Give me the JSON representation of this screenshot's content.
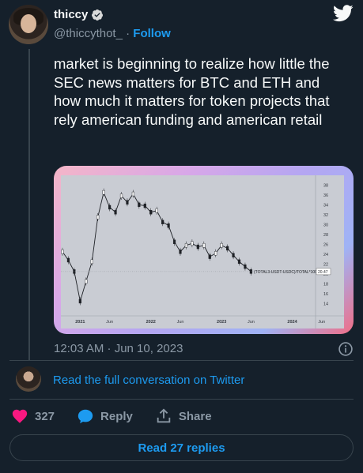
{
  "user": {
    "display_name": "thiccy",
    "handle": "@thiccythot_",
    "separator": "·",
    "follow_label": "Follow"
  },
  "tweet": {
    "text": "market is beginning to realize how little the SEC news matters for BTC and ETH and how much it matters for token projects that rely american funding and american retail",
    "timestamp": "12:03 AM · Jun 10, 2023"
  },
  "chart_data": {
    "type": "line",
    "title": "",
    "series_label": "(TOTAL3-USDT-USDC)/TOTAL*100",
    "last_value": "20.47",
    "x_ticks": [
      "2021",
      "Jun",
      "2022",
      "Jun",
      "2023",
      "Jun",
      "2024",
      "Jun"
    ],
    "y_ticks": [
      38,
      36,
      34,
      32,
      30,
      28,
      26,
      24,
      22,
      20,
      18,
      16,
      14
    ],
    "ylim": [
      12.5,
      39
    ],
    "x": [
      "2020-10",
      "2020-11",
      "2020-12",
      "2021-01",
      "2021-02",
      "2021-03",
      "2021-04",
      "2021-05",
      "2021-06",
      "2021-07",
      "2021-08",
      "2021-09",
      "2021-10",
      "2021-11",
      "2021-12",
      "2022-01",
      "2022-02",
      "2022-03",
      "2022-04",
      "2022-05",
      "2022-06",
      "2022-07",
      "2022-08",
      "2022-09",
      "2022-10",
      "2022-11",
      "2022-12",
      "2023-01",
      "2023-02",
      "2023-03",
      "2023-04",
      "2023-05",
      "2023-06"
    ],
    "values": [
      24.5,
      22.8,
      20.5,
      14.5,
      18.5,
      22.5,
      31.5,
      36.5,
      33.5,
      32.5,
      35.8,
      34.5,
      36.2,
      34.0,
      33.8,
      32.5,
      32.8,
      30.5,
      29.8,
      26.5,
      24.5,
      25.8,
      26.2,
      25.5,
      25.8,
      23.5,
      24.2,
      25.8,
      25.2,
      23.8,
      22.5,
      21.5,
      20.5
    ]
  },
  "links": {
    "read_conversation": "Read the full conversation on Twitter"
  },
  "actions": {
    "like_count": "327",
    "reply_label": "Reply",
    "share_label": "Share"
  },
  "read_replies": "Read 27 replies",
  "colors": {
    "background": "#15202b",
    "accent": "#1d9bf0",
    "like": "#f91880",
    "muted": "#8b98a5"
  }
}
